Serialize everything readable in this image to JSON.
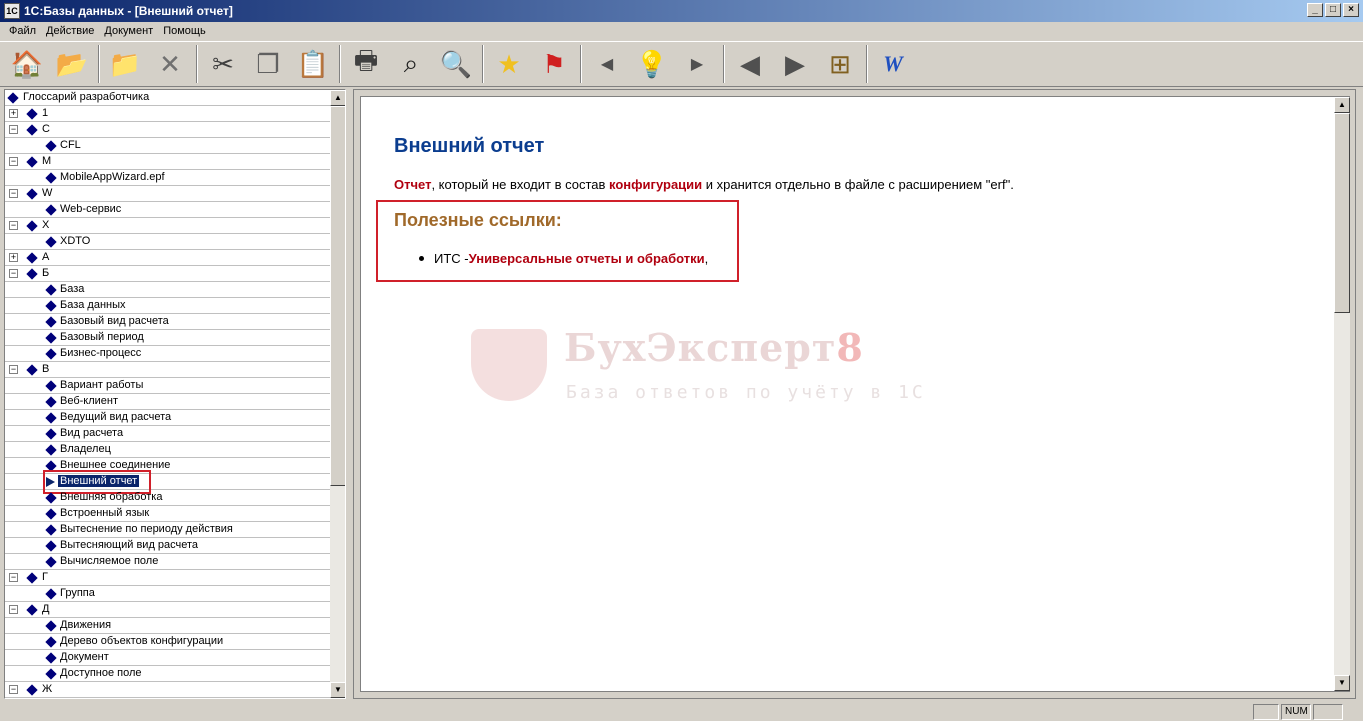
{
  "window": {
    "title": "1С:Базы данных - [Внешний отчет]",
    "min": "_",
    "max": "□",
    "close": "×"
  },
  "menu": [
    "Файл",
    "Действие",
    "Документ",
    "Помощь"
  ],
  "toolbar": [
    {
      "name": "home-icon",
      "glyph": "🏠"
    },
    {
      "name": "open-folder-icon",
      "glyph": "📂"
    },
    {
      "sep": true
    },
    {
      "name": "open-book-icon",
      "glyph": "📁"
    },
    {
      "name": "delete-icon",
      "glyph": "✕"
    },
    {
      "sep": true
    },
    {
      "name": "cut-icon",
      "glyph": "✂"
    },
    {
      "name": "copy-icon",
      "glyph": "❐"
    },
    {
      "name": "paste-icon",
      "glyph": "📋"
    },
    {
      "sep": true
    },
    {
      "name": "print-icon",
      "glyph": "🖶"
    },
    {
      "name": "binoculars-icon",
      "glyph": "⌕"
    },
    {
      "name": "preview-icon",
      "glyph": "🔍"
    },
    {
      "sep": true
    },
    {
      "name": "star-icon",
      "glyph": "★"
    },
    {
      "name": "flag-icon",
      "glyph": "⚑"
    },
    {
      "sep": true
    },
    {
      "name": "arrow-left-small-icon",
      "glyph": "◀"
    },
    {
      "name": "lightbulb-icon",
      "glyph": "💡"
    },
    {
      "name": "arrow-right-small-icon",
      "glyph": "▶"
    },
    {
      "sep": true
    },
    {
      "name": "back-icon",
      "glyph": "◀"
    },
    {
      "name": "forward-icon",
      "glyph": "▶"
    },
    {
      "name": "tree-sync-icon",
      "glyph": "⊞"
    },
    {
      "sep": true
    },
    {
      "name": "word-export-icon",
      "glyph": "W"
    }
  ],
  "tree": [
    {
      "level": 0,
      "label": "Глоссарий разработчика"
    },
    {
      "level": 1,
      "pm": "+",
      "label": "1"
    },
    {
      "level": 1,
      "pm": "−",
      "label": "C"
    },
    {
      "level": 2,
      "label": "CFL"
    },
    {
      "level": 1,
      "pm": "−",
      "label": "M"
    },
    {
      "level": 2,
      "label": "MobileAppWizard.epf"
    },
    {
      "level": 1,
      "pm": "−",
      "label": "W"
    },
    {
      "level": 2,
      "label": "Web-сервис"
    },
    {
      "level": 1,
      "pm": "−",
      "label": "X"
    },
    {
      "level": 2,
      "label": "XDTO"
    },
    {
      "level": 1,
      "pm": "+",
      "label": "А"
    },
    {
      "level": 1,
      "pm": "−",
      "label": "Б"
    },
    {
      "level": 2,
      "label": "База"
    },
    {
      "level": 2,
      "label": "База данных"
    },
    {
      "level": 2,
      "label": "Базовый вид расчета"
    },
    {
      "level": 2,
      "label": "Базовый период"
    },
    {
      "level": 2,
      "label": "Бизнес-процесс"
    },
    {
      "level": 1,
      "pm": "−",
      "label": "В"
    },
    {
      "level": 2,
      "label": "Вариант работы"
    },
    {
      "level": 2,
      "label": "Веб-клиент"
    },
    {
      "level": 2,
      "label": "Ведущий вид расчета"
    },
    {
      "level": 2,
      "label": "Вид расчета"
    },
    {
      "level": 2,
      "label": "Владелец"
    },
    {
      "level": 2,
      "label": "Внешнее соединение"
    },
    {
      "level": 2,
      "label": "Внешний отчет",
      "selected": true
    },
    {
      "level": 2,
      "label": "Внешняя обработка"
    },
    {
      "level": 2,
      "label": "Встроенный язык"
    },
    {
      "level": 2,
      "label": "Вытеснение по периоду действия"
    },
    {
      "level": 2,
      "label": "Вытесняющий вид расчета"
    },
    {
      "level": 2,
      "label": "Вычисляемое поле"
    },
    {
      "level": 1,
      "pm": "−",
      "label": "Г"
    },
    {
      "level": 2,
      "label": "Группа"
    },
    {
      "level": 1,
      "pm": "−",
      "label": "Д"
    },
    {
      "level": 2,
      "label": "Движения"
    },
    {
      "level": 2,
      "label": "Дерево объектов конфигурации"
    },
    {
      "level": 2,
      "label": "Документ"
    },
    {
      "level": 2,
      "label": "Доступное поле"
    },
    {
      "level": 1,
      "pm": "−",
      "label": "Ж"
    }
  ],
  "doc": {
    "title": "Внешний отчет",
    "para": {
      "term1": "Отчет",
      "text1": ", который не входит в состав ",
      "term2": "конфигурации",
      "text2": " и хранится отдельно в файле с расширением \"erf\"."
    },
    "links_heading": "Полезные ссылки:",
    "link_prefix": "ИТС - ",
    "link_text": "Универсальные отчеты и обработки",
    "link_suffix": ","
  },
  "watermark": {
    "title": "БухЭксперт",
    "title_digit": "8",
    "subtitle": "База ответов по учёту в 1С"
  },
  "status": {
    "num": "NUM"
  },
  "colors": {
    "selection": "#0a246a",
    "highlight_box": "#d0202a",
    "heading": "#0b3d8f",
    "term": "#b0000f"
  }
}
